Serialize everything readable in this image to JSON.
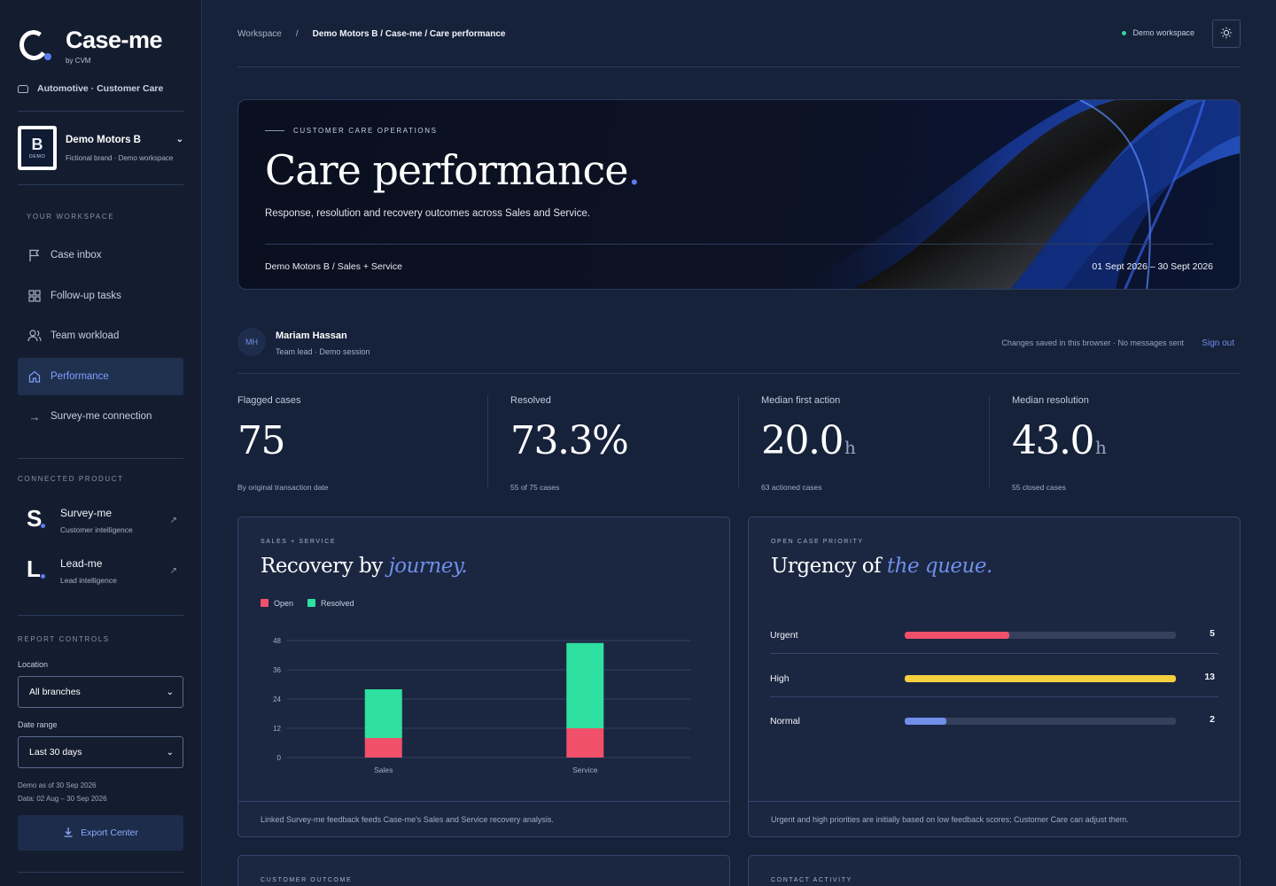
{
  "app": {
    "title": "Case-me",
    "byline": "by CVM",
    "industry": "Automotive · Customer Care"
  },
  "brand": {
    "letter": "B",
    "badge": "DEMO",
    "name": "Demo Motors B",
    "note": "Fictional brand · Demo workspace"
  },
  "sidebar": {
    "workspace_label": "YOUR WORKSPACE",
    "items": [
      {
        "label": "Case inbox",
        "icon": "flag-icon"
      },
      {
        "label": "Follow-up tasks",
        "icon": "grid-icon"
      },
      {
        "label": "Team workload",
        "icon": "users-icon"
      },
      {
        "label": "Performance",
        "icon": "home-icon"
      },
      {
        "label": "Survey-me connection",
        "icon": "arrow-right-icon"
      }
    ],
    "active_index": 3,
    "connected_label": "CONNECTED PRODUCT",
    "products": [
      {
        "mark": "S",
        "name": "Survey-me",
        "desc": "Customer intelligence"
      },
      {
        "mark": "L",
        "name": "Lead-me",
        "desc": "Lead intelligence"
      }
    ],
    "controls_label": "REPORT CONTROLS",
    "location_label": "Location",
    "location_value": "All branches",
    "daterange_label": "Date range",
    "daterange_value": "Last 30 days",
    "demo_asof": "Demo as of 30 Sep 2026",
    "demo_data": "Data: 02 Aug – 30 Sep 2026",
    "export_label": "Export Center"
  },
  "topbar": {
    "crumb_root": "Workspace",
    "crumb_sep": "/",
    "crumb_current": "Demo Motors B / Case-me / Care performance",
    "workspace_status": "Demo workspace"
  },
  "hero": {
    "kicker": "CUSTOMER CARE OPERATIONS",
    "title": "Care performance",
    "title_dot": ".",
    "subtitle": "Response, resolution and recovery outcomes across Sales and Service.",
    "scope": "Demo Motors B / Sales + Service",
    "period": "01 Sept 2026 – 30 Sept 2026"
  },
  "user": {
    "initials": "MH",
    "name": "Mariam Hassan",
    "role": "Team lead · Demo session",
    "save_note": "Changes saved in this browser · No messages sent",
    "signout": "Sign out"
  },
  "kpis": [
    {
      "label": "Flagged cases",
      "value": "75",
      "unit": "",
      "note": "By original transaction date"
    },
    {
      "label": "Resolved",
      "value": "73.3%",
      "unit": "",
      "note": "55 of 75 cases"
    },
    {
      "label": "Median first action",
      "value": "20.0",
      "unit": "h",
      "note": "63 actioned cases"
    },
    {
      "label": "Median resolution",
      "value": "43.0",
      "unit": "h",
      "note": "55 closed cases"
    }
  ],
  "recovery": {
    "kicker": "SALES + SERVICE",
    "title_plain": "Recovery by ",
    "title_em": "journey.",
    "footer": "Linked Survey-me feedback feeds Case-me's Sales and Service recovery analysis."
  },
  "urgency": {
    "kicker": "OPEN CASE PRIORITY",
    "title_plain": "Urgency of ",
    "title_em": "the queue.",
    "rows": [
      {
        "label": "Urgent",
        "count": "5",
        "fraction": 0.385,
        "color": "#f0506a"
      },
      {
        "label": "High",
        "count": "13",
        "fraction": 1.0,
        "color": "#f5d03d"
      },
      {
        "label": "Normal",
        "count": "2",
        "fraction": 0.154,
        "color": "#6f8fe8"
      }
    ],
    "footer": "Urgent and high priorities are initially based on low feedback scores; Customer Care can adjust them."
  },
  "lower_cards": {
    "left_kicker": "CUSTOMER OUTCOME",
    "right_kicker": "CONTACT ACTIVITY"
  },
  "chart_data": {
    "type": "bar",
    "stacked": true,
    "categories": [
      "Sales",
      "Service"
    ],
    "series": [
      {
        "name": "Open",
        "values": [
          8,
          12
        ],
        "color": "#f0506a"
      },
      {
        "name": "Resolved",
        "values": [
          20,
          35
        ],
        "color": "#2fe0a0"
      }
    ],
    "yticks": [
      "0",
      "12",
      "24",
      "36",
      "48"
    ],
    "ylim": [
      0,
      48
    ],
    "grid": true,
    "legend": "top-left"
  }
}
